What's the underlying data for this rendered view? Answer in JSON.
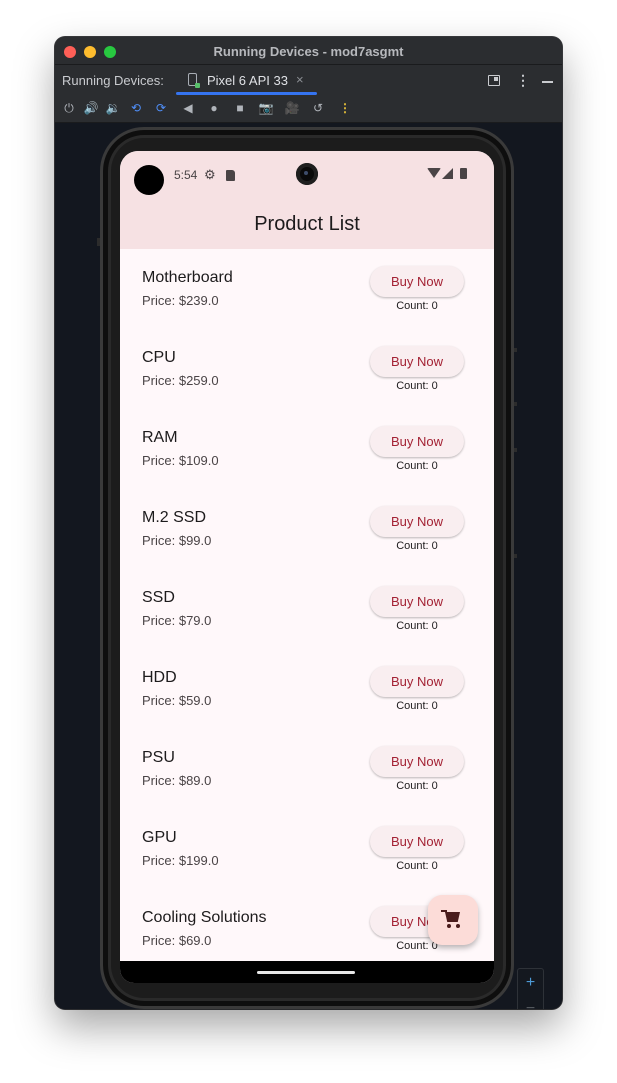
{
  "window": {
    "title": "Running Devices - mod7asgmt"
  },
  "tabbar": {
    "label": "Running Devices:",
    "device_tab": "Pixel 6 API 33",
    "close_glyph": "×"
  },
  "toolbar": {
    "icons": [
      "power-icon",
      "volume-up-icon",
      "volume-down-icon",
      "rotate-left-icon",
      "rotate-right-icon",
      "back-icon",
      "home-icon",
      "overview-icon",
      "screenshot-icon",
      "screen-record-icon",
      "snapshot-icon",
      "more-icon"
    ]
  },
  "zoom": {
    "plus": "+",
    "minus": "−"
  },
  "status": {
    "time": "5:54"
  },
  "app": {
    "title": "Product List"
  },
  "products": [
    {
      "name": "Motherboard",
      "price": "Price: $239.0",
      "button": "Buy Now",
      "count": "Count: 0"
    },
    {
      "name": "CPU",
      "price": "Price: $259.0",
      "button": "Buy Now",
      "count": "Count: 0"
    },
    {
      "name": "RAM",
      "price": "Price: $109.0",
      "button": "Buy Now",
      "count": "Count: 0"
    },
    {
      "name": "M.2 SSD",
      "price": "Price: $99.0",
      "button": "Buy Now",
      "count": "Count: 0"
    },
    {
      "name": "SSD",
      "price": "Price: $79.0",
      "button": "Buy Now",
      "count": "Count: 0"
    },
    {
      "name": "HDD",
      "price": "Price: $59.0",
      "button": "Buy Now",
      "count": "Count: 0"
    },
    {
      "name": "PSU",
      "price": "Price: $89.0",
      "button": "Buy Now",
      "count": "Count: 0"
    },
    {
      "name": "GPU",
      "price": "Price: $199.0",
      "button": "Buy Now",
      "count": "Count: 0"
    },
    {
      "name": "Cooling Solutions",
      "price": "Price: $69.0",
      "button": "Buy Now",
      "count": "Count: 0"
    }
  ],
  "colors": {
    "accent": "#a32133",
    "header_bg": "#f6e1e3",
    "fab_bg": "#fcdcd8",
    "ide_tab_underline": "#3574f0"
  }
}
